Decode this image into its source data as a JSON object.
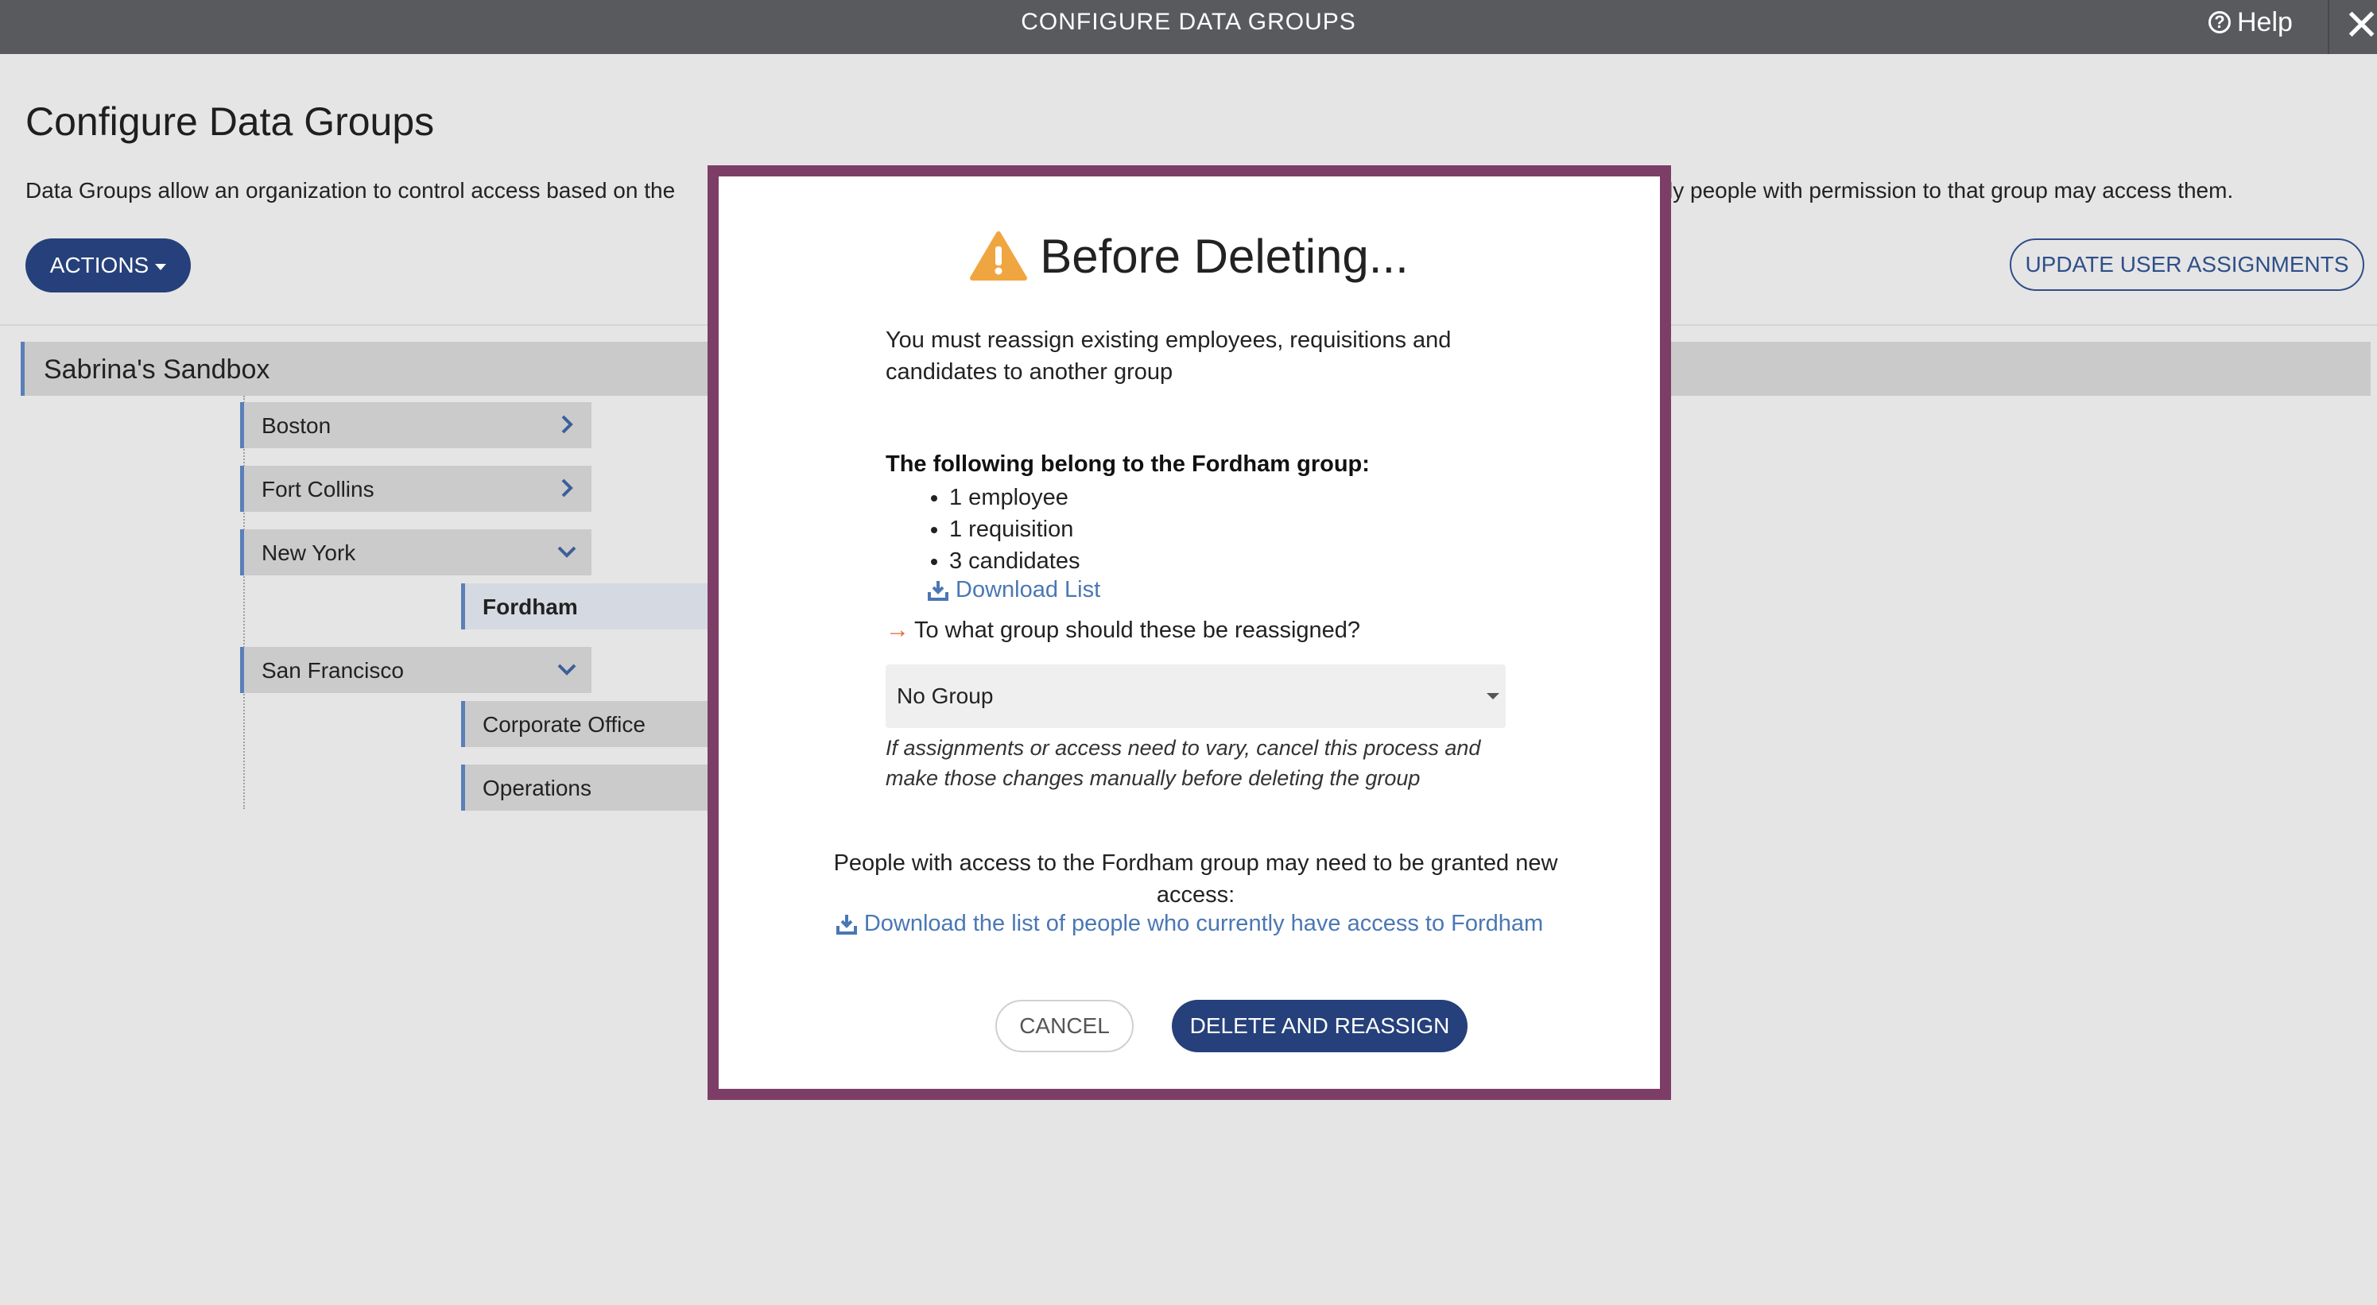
{
  "topbar": {
    "title": "CONFIGURE DATA GROUPS",
    "help_label": "Help",
    "help_icon": "question-circle-icon",
    "close_icon": "close-icon"
  },
  "page": {
    "title": "Configure Data Groups",
    "intro_left": "Data Groups allow an organization to control access based on the",
    "intro_right": "ly people with permission to that group may access them.",
    "actions_label": "ACTIONS",
    "update_label": "UPDATE USER ASSIGNMENTS"
  },
  "tree": {
    "root": "Sabrina's Sandbox",
    "nodes": [
      {
        "label": "Boston",
        "chevron": "chevron-right-icon"
      },
      {
        "label": "Fort Collins",
        "chevron": "chevron-right-icon"
      },
      {
        "label": "New York",
        "chevron": "chevron-down-icon"
      },
      {
        "label": "Fordham"
      },
      {
        "label": "San Francisco",
        "chevron": "chevron-down-icon"
      },
      {
        "label": "Corporate Office"
      },
      {
        "label": "Operations"
      }
    ]
  },
  "modal": {
    "title": "Before Deleting...",
    "title_icon": "warning-icon",
    "lead": "You must reassign existing employees, requisitions and candidates to another group",
    "belong_heading": "The following belong to the Fordham group:",
    "items": [
      "1 employee",
      "1 requisition",
      "3 candidates"
    ],
    "download_list": "Download List",
    "question": "To what group should these be reassigned?",
    "select_value": "No Group",
    "note": "If assignments or access need to vary, cancel this process and make those changes manually before deleting the group",
    "access_text": "People with access to the Fordham group may need to be granted new access:",
    "download_access": "Download the list of people who currently have access to Fordham",
    "cancel_label": "CANCEL",
    "delete_label": "DELETE AND REASSIGN"
  },
  "colors": {
    "topbar": "#585a5e",
    "primary_button": "#25407a",
    "modal_border": "#7c3e66",
    "link": "#4a77b4",
    "warning": "#f0a640",
    "arrow": "#e0652c",
    "tree_accent": "#5b7fb8"
  }
}
